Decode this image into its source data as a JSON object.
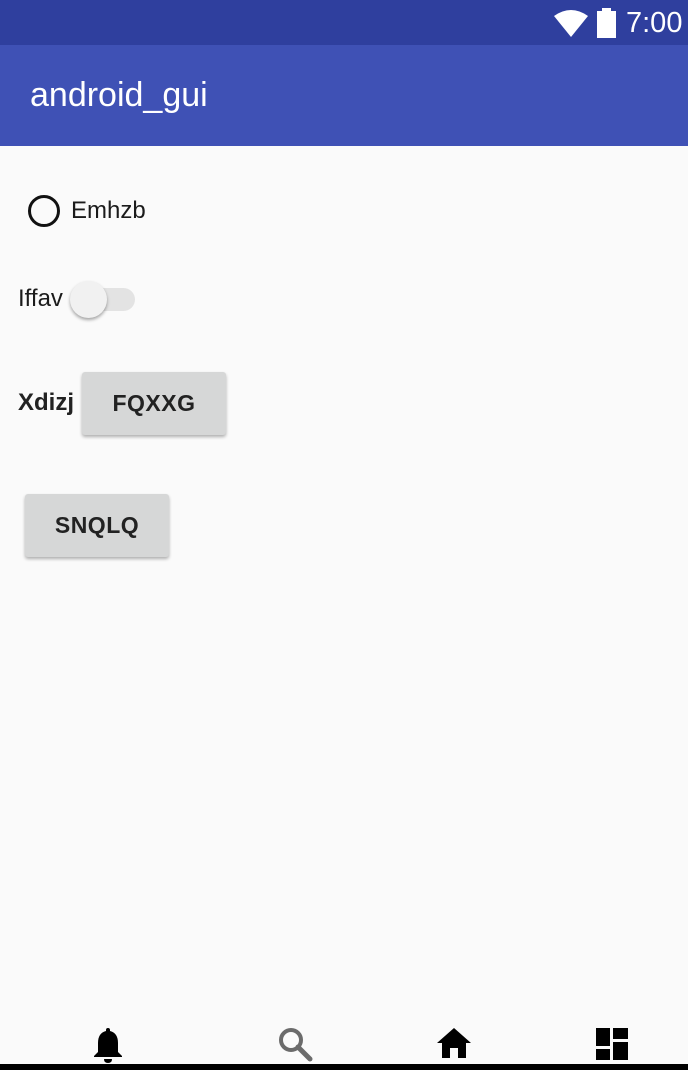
{
  "status_bar": {
    "time": "7:00",
    "wifi_icon": "wifi-icon",
    "battery_icon": "battery-icon"
  },
  "app_bar": {
    "title": "android_gui",
    "color": "#3f51b5"
  },
  "content": {
    "radio": {
      "label": "Emhzb",
      "checked": false
    },
    "switch": {
      "label": "Iffav",
      "on": false
    },
    "labeled_button": {
      "label": "Xdizj",
      "button_label": "FQXXG"
    },
    "button": {
      "label": "SNQLQ"
    }
  },
  "bottom_nav": {
    "items": [
      {
        "icon": "bell-icon"
      },
      {
        "icon": "search-icon"
      },
      {
        "icon": "home-icon"
      },
      {
        "icon": "dashboard-icon"
      }
    ]
  }
}
